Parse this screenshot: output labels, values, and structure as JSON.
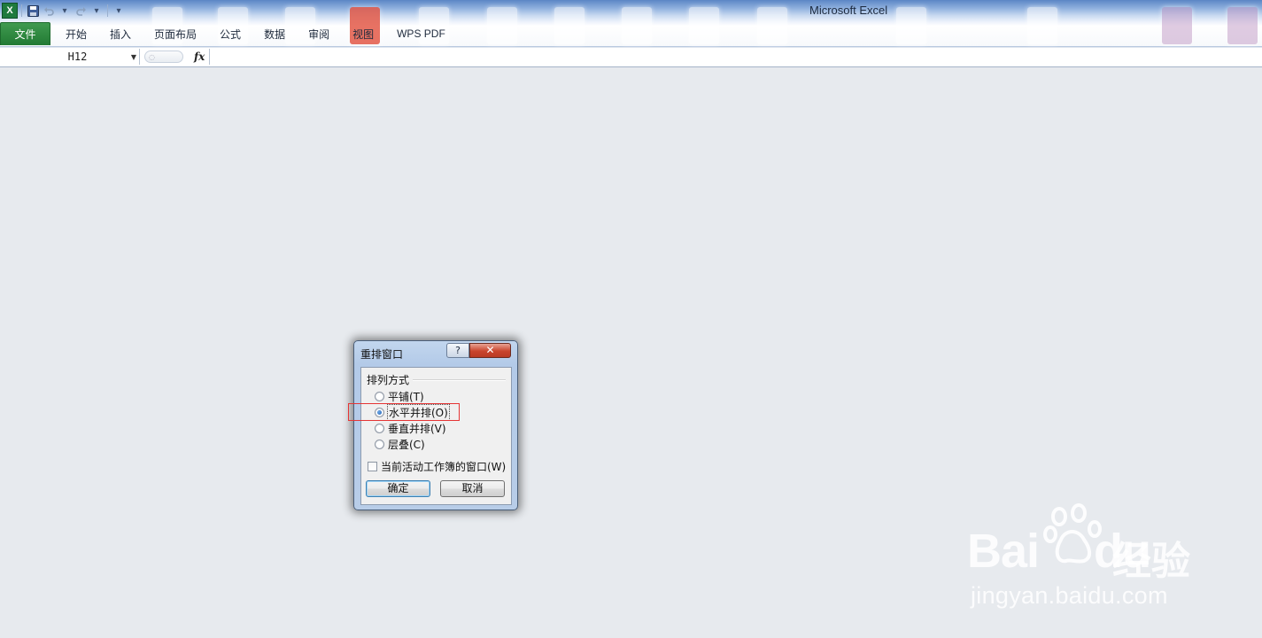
{
  "app": {
    "title": "Microsoft Excel",
    "logo_letter": "X"
  },
  "ribbon": {
    "tabs": [
      "文件",
      "开始",
      "插入",
      "页面布局",
      "公式",
      "数据",
      "审阅",
      "视图",
      "WPS PDF"
    ]
  },
  "formula_bar": {
    "name_box": "H12",
    "fx_label": "fx",
    "formula": ""
  },
  "dialog": {
    "title": "重排窗口",
    "help_label": "?",
    "close_label": "✕",
    "group_label": "排列方式",
    "options": [
      "平铺(T)",
      "水平并排(O)",
      "垂直并排(V)",
      "层叠(C)"
    ],
    "selected_option": "水平并排(O)",
    "checkbox_label": "当前活动工作簿的窗口(W)",
    "checkbox_checked": false,
    "ok_label": "确定",
    "cancel_label": "取消"
  },
  "watermark": {
    "brand_text": "Bai",
    "brand_suffix": "du",
    "product": "经验",
    "url": "jingyan.baidu.com"
  },
  "colors": {
    "file_tab": "#227a34",
    "highlight": "#e53535",
    "close_button": "#c9442d"
  }
}
